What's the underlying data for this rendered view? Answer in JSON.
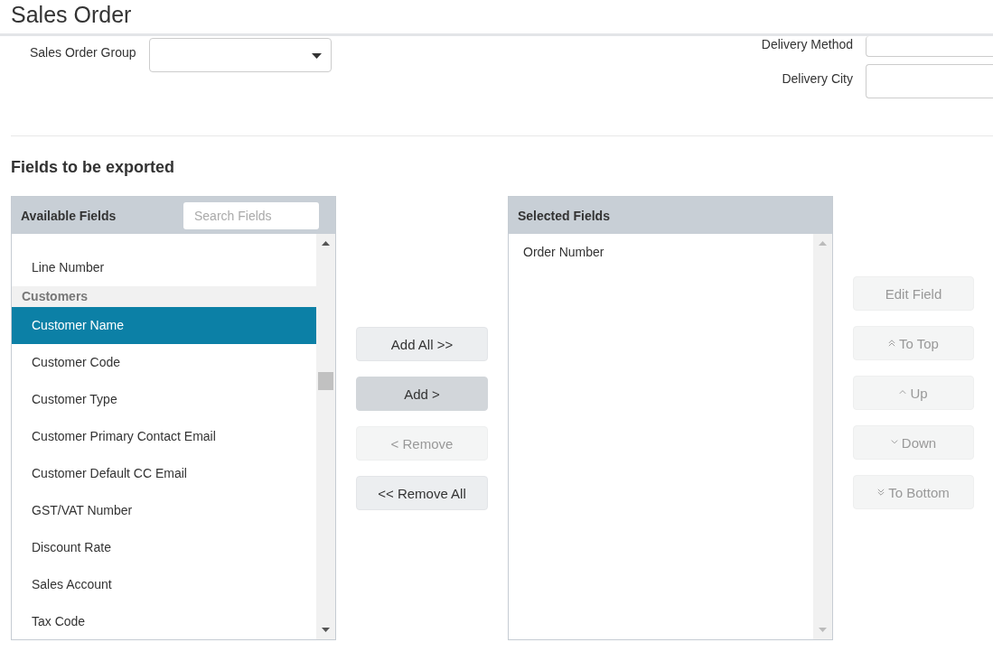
{
  "page": {
    "title": "Sales Order"
  },
  "form": {
    "left": [
      {
        "label": "Sales Order Group",
        "kind": "select"
      }
    ],
    "right": [
      {
        "label": "Delivery Method"
      },
      {
        "label": "Delivery City"
      }
    ]
  },
  "export": {
    "title": "Fields to be exported",
    "available": {
      "title": "Available Fields",
      "search": {
        "placeholder": "Search Fields"
      },
      "items": [
        {
          "kind": "field",
          "label": "Line Number",
          "selected": false
        },
        {
          "kind": "group",
          "label": "Customers"
        },
        {
          "kind": "field",
          "label": "Customer Name",
          "selected": true
        },
        {
          "kind": "field",
          "label": "Customer Code",
          "selected": false
        },
        {
          "kind": "field",
          "label": "Customer Type",
          "selected": false
        },
        {
          "kind": "field",
          "label": "Customer Primary Contact Email",
          "selected": false
        },
        {
          "kind": "field",
          "label": "Customer Default CC Email",
          "selected": false
        },
        {
          "kind": "field",
          "label": "GST/VAT Number",
          "selected": false
        },
        {
          "kind": "field",
          "label": "Discount Rate",
          "selected": false
        },
        {
          "kind": "field",
          "label": "Sales Account",
          "selected": false
        },
        {
          "kind": "field",
          "label": "Tax Code",
          "selected": false
        }
      ]
    },
    "transfer_buttons": [
      {
        "label": "Add All >>",
        "disabled": false,
        "highlighted": false
      },
      {
        "label": "Add >",
        "disabled": false,
        "highlighted": true
      },
      {
        "label": "< Remove",
        "disabled": true,
        "highlighted": false
      },
      {
        "label": "<< Remove All",
        "disabled": false,
        "highlighted": false
      }
    ],
    "selected": {
      "title": "Selected Fields",
      "items": [
        {
          "label": "Order Number",
          "selected": false
        }
      ]
    },
    "order_buttons": [
      {
        "label": "Edit Field",
        "kind": "plain",
        "disabled": true
      },
      {
        "label": "To Top",
        "kind": "double-up",
        "disabled": true
      },
      {
        "label": "Up",
        "kind": "up",
        "disabled": true
      },
      {
        "label": "Down",
        "kind": "down",
        "disabled": true
      },
      {
        "label": "To Bottom",
        "kind": "double-down",
        "disabled": true
      }
    ]
  }
}
